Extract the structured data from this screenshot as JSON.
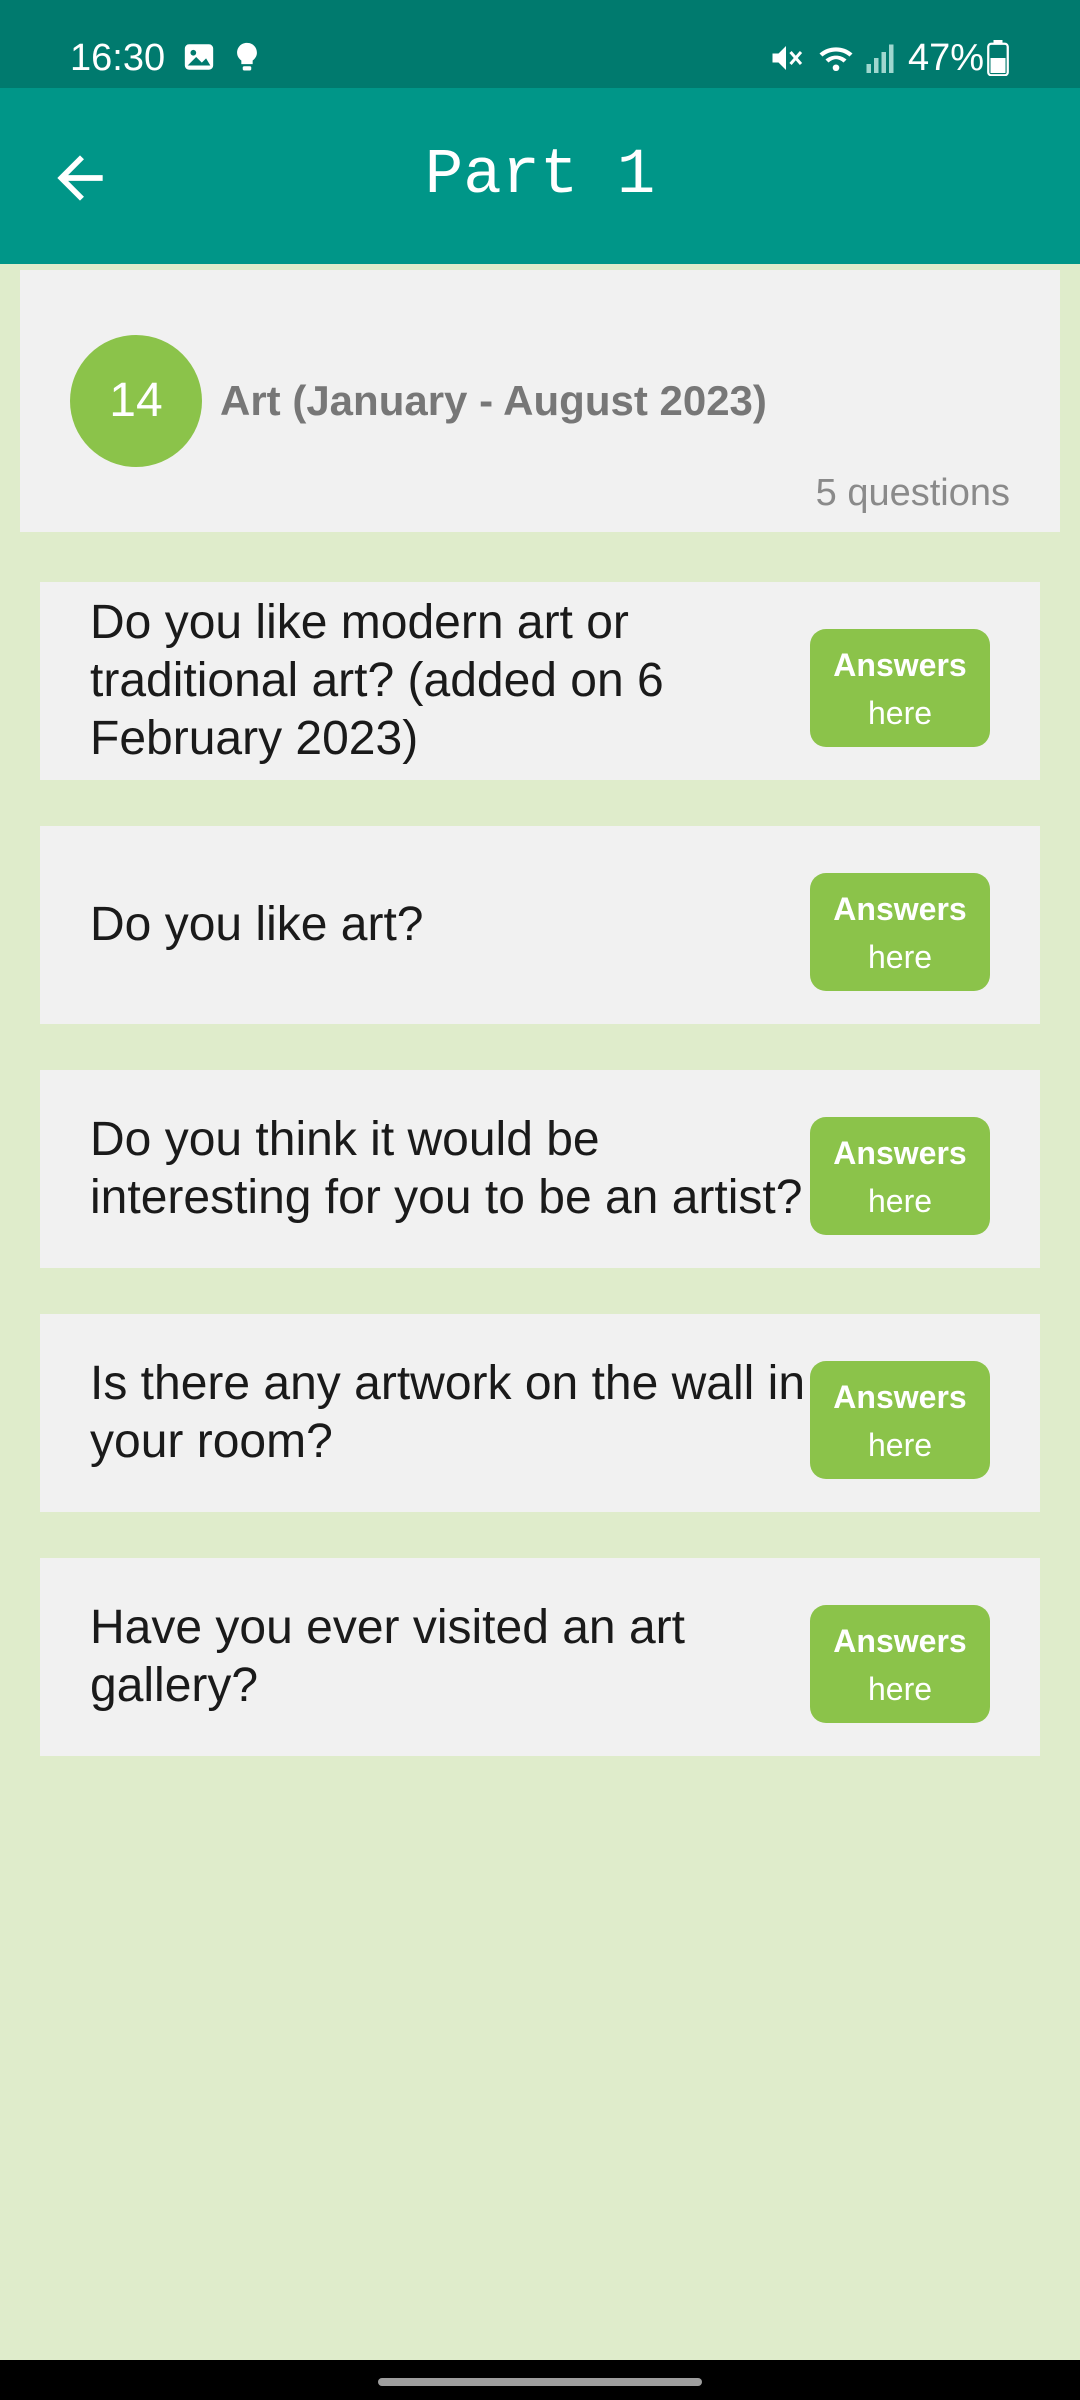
{
  "status_bar": {
    "time": "16:30",
    "battery": "47%",
    "icons_left": [
      "image-icon",
      "lightbulb-icon"
    ],
    "icons_right": [
      "mute-icon",
      "wifi-icon",
      "signal-icon",
      "battery-icon"
    ]
  },
  "app_bar": {
    "title": "Part 1",
    "back_icon": "arrow-left-icon"
  },
  "topic": {
    "number": "14",
    "title": "Art (January - August 2023)",
    "count": "5 questions"
  },
  "questions": [
    {
      "text": "Do you like modern art or traditional art? (added on 6 February 2023)",
      "button_line1": "Answers",
      "button_line2": "here"
    },
    {
      "text": "Do you like art?",
      "button_line1": "Answers",
      "button_line2": "here"
    },
    {
      "text": "Do you think it would be interesting for you to be an artist?",
      "button_line1": "Answers",
      "button_line2": "here"
    },
    {
      "text": "Is there any artwork on the wall in your room?",
      "button_line1": "Answers",
      "button_line2": "here"
    },
    {
      "text": "Have you ever visited an art gallery?",
      "button_line1": "Answers",
      "button_line2": "here"
    }
  ],
  "colors": {
    "status_bar": "#007a6e",
    "app_bar": "#009688",
    "accent_green": "#8bc34a",
    "background": "#dfeccb",
    "card": "#f1f1f1"
  }
}
